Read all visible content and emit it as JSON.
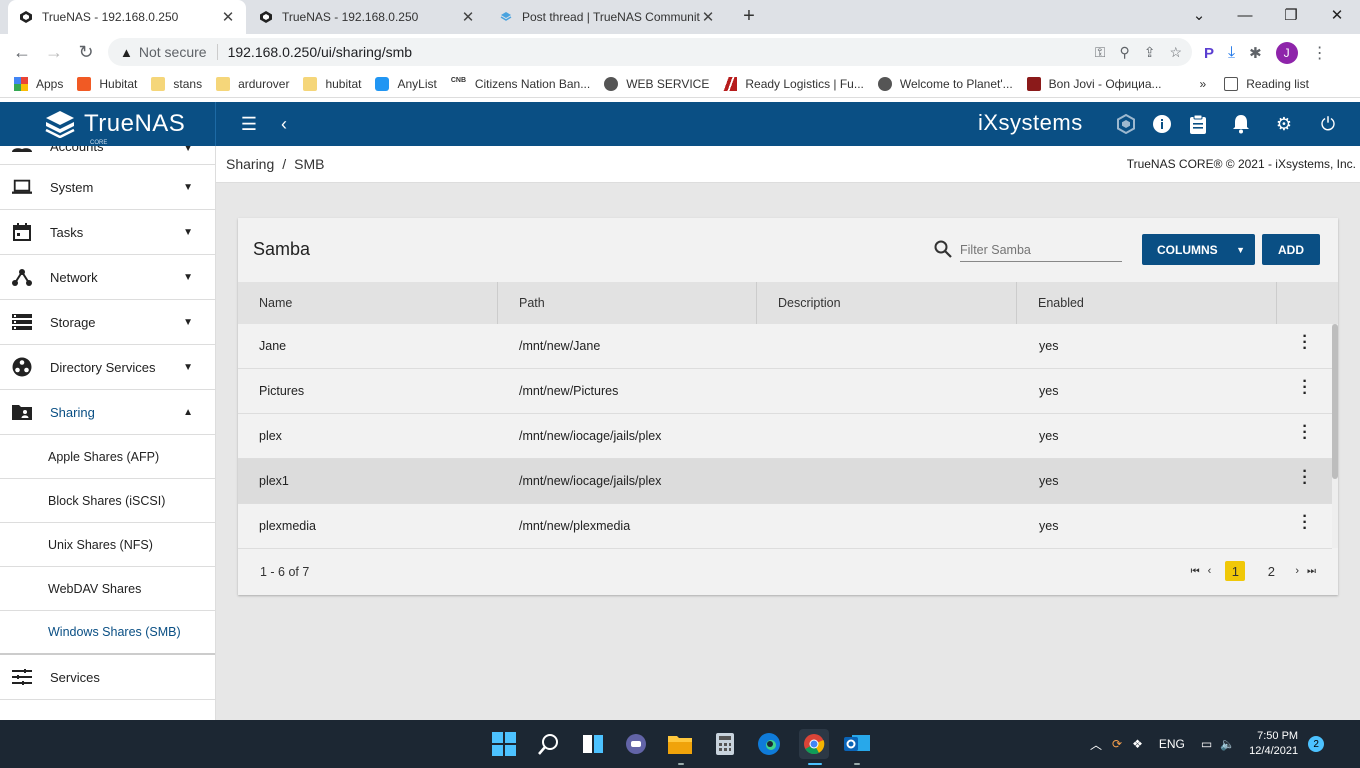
{
  "browser": {
    "tabs": [
      {
        "title": "TrueNAS - 192.168.0.250",
        "active": true
      },
      {
        "title": "TrueNAS - 192.168.0.250",
        "active": false
      },
      {
        "title": "Post thread | TrueNAS Communit",
        "active": false
      }
    ],
    "new_tab": "+",
    "not_secure": "Not secure",
    "url": "192.168.0.250/ui/sharing/smb",
    "bookmarks": [
      "Apps",
      "Hubitat",
      "stans",
      "ardurover",
      "hubitat",
      "AnyList",
      "Citizens Nation Ban...",
      "WEB SERVICE",
      "Ready Logistics | Fu...",
      "Welcome to Planet'...",
      "Bon Jovi - Официа..."
    ],
    "more_bookmarks": "»",
    "reading_list": "Reading list",
    "profile_initial": "J"
  },
  "header": {
    "logo": "TrueNAS",
    "logo_sub": "CORE",
    "vendor": "iXsystems"
  },
  "sidebar": {
    "items": [
      {
        "label": "Accounts",
        "icon": "people-icon"
      },
      {
        "label": "System",
        "icon": "laptop-icon"
      },
      {
        "label": "Tasks",
        "icon": "calendar-icon"
      },
      {
        "label": "Network",
        "icon": "network-icon"
      },
      {
        "label": "Storage",
        "icon": "storage-icon"
      },
      {
        "label": "Directory Services",
        "icon": "directory-icon"
      },
      {
        "label": "Sharing",
        "icon": "folder-shared-icon"
      }
    ],
    "sharing_sub": [
      "Apple Shares (AFP)",
      "Block Shares (iSCSI)",
      "Unix Shares (NFS)",
      "WebDAV Shares",
      "Windows Shares (SMB)"
    ],
    "services": "Services"
  },
  "breadcrumb": {
    "parent": "Sharing",
    "sep": "/",
    "current": "SMB",
    "copyright": "TrueNAS CORE® © 2021 - iXsystems, Inc."
  },
  "card": {
    "title": "Samba",
    "filter_placeholder": "Filter Samba",
    "columns_btn": "COLUMNS",
    "add_btn": "ADD",
    "headers": [
      "Name",
      "Path",
      "Description",
      "Enabled"
    ],
    "rows": [
      {
        "name": "Jane",
        "path": "/mnt/new/Jane",
        "description": "",
        "enabled": "yes"
      },
      {
        "name": "Pictures",
        "path": "/mnt/new/Pictures",
        "description": "",
        "enabled": "yes"
      },
      {
        "name": "plex",
        "path": "/mnt/new/iocage/jails/plex",
        "description": "",
        "enabled": "yes"
      },
      {
        "name": "plex1",
        "path": "/mnt/new/iocage/jails/plex",
        "description": "",
        "enabled": "yes"
      },
      {
        "name": "plexmedia",
        "path": "/mnt/new/plexmedia",
        "description": "",
        "enabled": "yes"
      }
    ],
    "range": "1 - 6 of 7",
    "pages": [
      "1",
      "2"
    ],
    "current_page": "1"
  },
  "taskbar": {
    "lang": "ENG",
    "time": "7:50 PM",
    "date": "12/4/2021",
    "notif_count": "2"
  },
  "colors": {
    "primary": "#0a4f84",
    "page_highlight": "#f0c808",
    "taskbar": "#1c2733"
  }
}
